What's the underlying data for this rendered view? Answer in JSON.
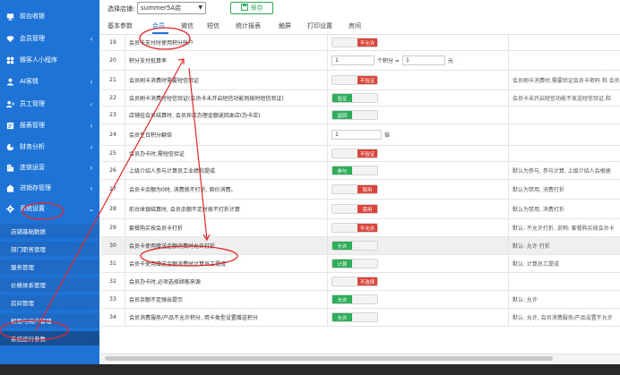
{
  "sidebar": {
    "items": [
      {
        "label": "前台收银",
        "icon": "monitor-icon",
        "chevron": ""
      },
      {
        "label": "会员管理",
        "icon": "diamond-icon",
        "chevron": "‹"
      },
      {
        "label": "微客人小程序",
        "icon": "apps-icon",
        "chevron": ""
      },
      {
        "label": "AI客情",
        "icon": "user-icon",
        "chevron": "‹"
      },
      {
        "label": "员工管理",
        "icon": "staff-icon",
        "chevron": "‹"
      },
      {
        "label": "报表管理",
        "icon": "report-icon",
        "chevron": "‹"
      },
      {
        "label": "财务分析",
        "icon": "pie-chart-icon",
        "chevron": "‹"
      },
      {
        "label": "连锁运营",
        "icon": "building-icon",
        "chevron": "‹"
      },
      {
        "label": "进销存管理",
        "icon": "inventory-icon",
        "chevron": "‹"
      },
      {
        "label": "系统设置",
        "icon": "gear-icon",
        "chevron": "⌄"
      }
    ],
    "sub_items": [
      "店铺基础数据",
      "部门职务管理",
      "服务管理",
      "价格体系管理",
      "房间管理",
      "权限与用户管理",
      "系统运行参数"
    ]
  },
  "top": {
    "store_label": "选择店铺:",
    "store_value": "summer5A店",
    "save_label": "保存"
  },
  "tabs": [
    "基本参数",
    "会员",
    "微信",
    "短信",
    "统计报表",
    "触屏",
    "打印设置",
    "房间"
  ],
  "rows": [
    {
      "num": "19",
      "name": "会员卡支付时使用积分账户",
      "ctrl": "toggle-off",
      "off_label": "不允许",
      "desc": ""
    },
    {
      "num": "20",
      "name": "积分支付抵算率",
      "ctrl": "rate",
      "value1": "1",
      "mid": "个积分 =",
      "value2": "1",
      "unit": "元",
      "desc": ""
    },
    {
      "num": "21",
      "name": "会员刷卡消费时需要短信验证",
      "ctrl": "toggle-off",
      "off_label": "不验证",
      "desc": "会员刷卡消费时,需要验证会员卡密码 和 会员"
    },
    {
      "num": "22",
      "name": "会员刷卡消费时短信验证(会员卡未开启短信功能则按时短信验证)",
      "ctrl": "toggle-on",
      "on_label": "验证",
      "desc": "会员卡未开启短信功能不发送短信验证,和"
    },
    {
      "num": "23",
      "name": "店铺挂会员结算时, 会员异店办理金额返回本店(办卡店)",
      "ctrl": "toggle-on",
      "on_label": "返回",
      "desc": ""
    },
    {
      "num": "24",
      "name": "会员生日积分翻倍",
      "ctrl": "number",
      "value1": "1",
      "unit": "倍",
      "desc": ""
    },
    {
      "num": "25",
      "name": "会员办卡时,需短信验证",
      "ctrl": "toggle-off",
      "off_label": "不验证",
      "desc": ""
    },
    {
      "num": "26",
      "name": "上级介绍人参与计算员工业绩和提成",
      "ctrl": "toggle-on",
      "on_label": "参与",
      "desc": "默认为参与, 参与计算, 上级介绍人会根据"
    },
    {
      "num": "27",
      "name": "会员卡余额为0时, 消费就不打折, 原价消费。",
      "ctrl": "toggle-off",
      "off_label": "禁用",
      "desc": "默认为禁用, 消费打折"
    },
    {
      "num": "28",
      "name": "前台收银结算时, 会员余额不足时按不打折计算",
      "ctrl": "toggle-off",
      "off_label": "禁用",
      "desc": "默认为禁用, 消费打折"
    },
    {
      "num": "29",
      "name": "套餐购买按会员卡打折",
      "ctrl": "toggle-off",
      "off_label": "不允许",
      "desc": "默认: 不允许打折, 说明: 套餐购买按会员卡"
    },
    {
      "num": "30",
      "name": "会员卡使用赠送金额消费时允许打折",
      "ctrl": "toggle-on",
      "on_label": "允许",
      "desc": "默认: 允许 打折",
      "highlight": true
    },
    {
      "num": "31",
      "name": "会员卡使用赠送金额消费时计算员工提成",
      "ctrl": "toggle-on",
      "on_label": "计算",
      "desc": "默认: 计算员工提成"
    },
    {
      "num": "32",
      "name": "会员办卡时,必须选择顾客来源",
      "ctrl": "toggle-off",
      "off_label": "不选择",
      "desc": ""
    },
    {
      "num": "33",
      "name": "会员余额不足弹出提示",
      "ctrl": "toggle-on",
      "on_label": "允许",
      "desc": "默认: 允许"
    },
    {
      "num": "34",
      "name": "会员消费服务/产品不允许积分, 用卡类型设置赠送积分",
      "ctrl": "toggle-on",
      "on_label": "允许",
      "desc": "默认: 允许, 会员消费服务/产品设置不允许"
    }
  ],
  "colors": {
    "sidebar": "#1e74d6",
    "accent": "#1e74d6",
    "on": "#2eae5a",
    "off": "#d9453a",
    "annotation": "#e0282a"
  }
}
